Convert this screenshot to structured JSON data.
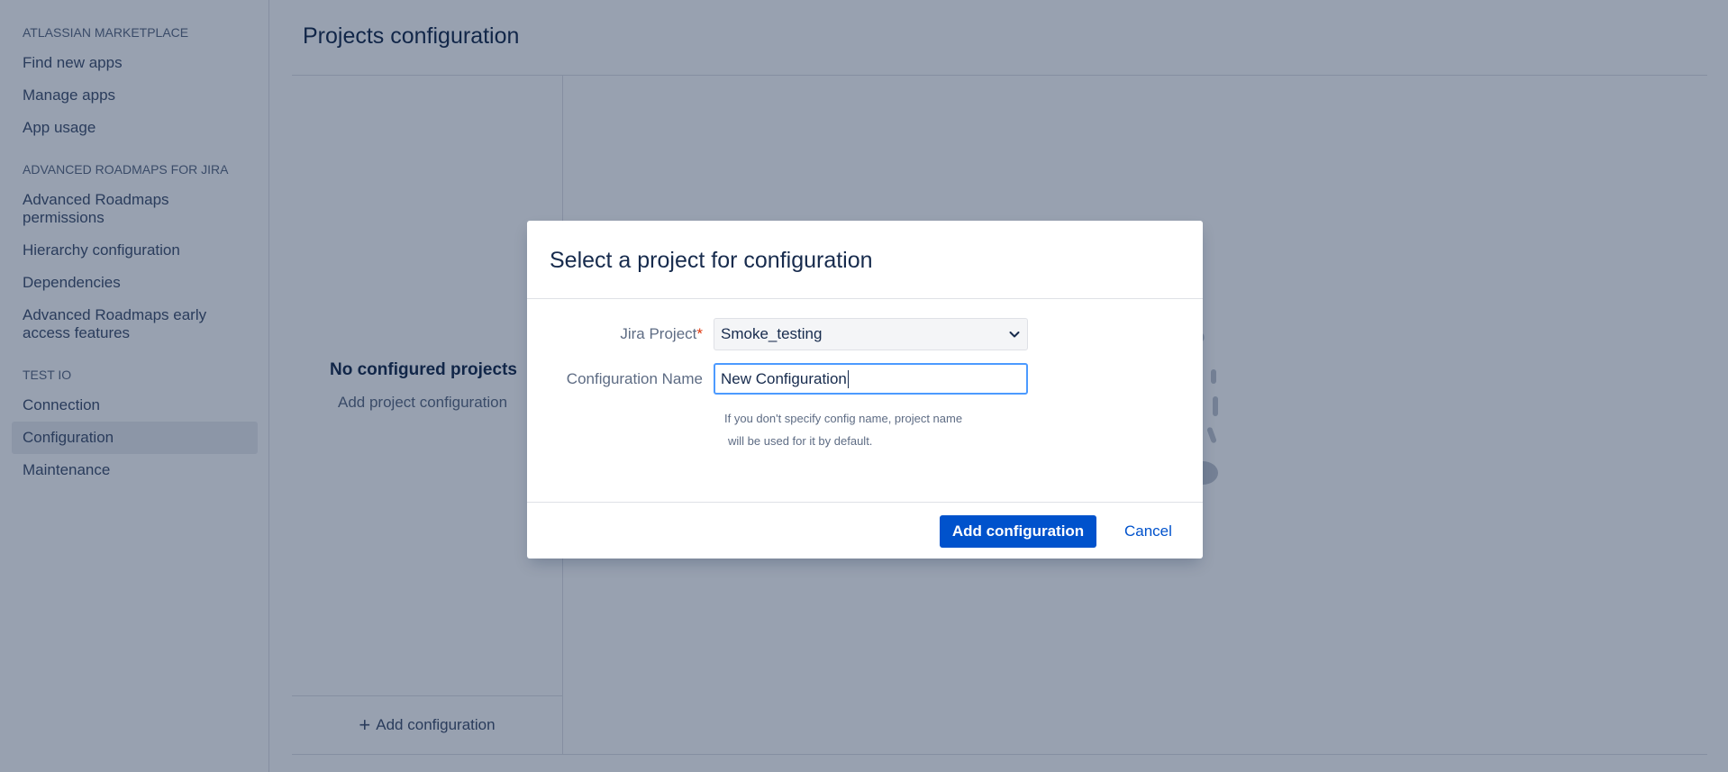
{
  "sidebar": {
    "groups": [
      {
        "title": "ATLASSIAN MARKETPLACE",
        "items": [
          "Find new apps",
          "Manage apps",
          "App usage"
        ]
      },
      {
        "title": "ADVANCED ROADMAPS FOR JIRA",
        "items": [
          "Advanced Roadmaps permissions",
          "Hierarchy configuration",
          "Dependencies",
          "Advanced Roadmaps early access features"
        ]
      },
      {
        "title": "TEST IO",
        "items": [
          "Connection",
          "Configuration",
          "Maintenance"
        ],
        "active": "Configuration"
      }
    ]
  },
  "main": {
    "title": "Projects configuration",
    "empty_title": "No configured projects",
    "empty_subtitle": "Add project configuration",
    "add_configuration_label": "Add configuration"
  },
  "modal": {
    "title": "Select a project for configuration",
    "jira_project_label": "Jira Project",
    "required_mark": "*",
    "jira_project_value": "Smoke_testing",
    "config_name_label": "Configuration Name",
    "config_name_value": "New Configuration",
    "help_line1": "If you don't specify config name, project name",
    "help_line2": "will be used for it by default.",
    "primary_button": "Add configuration",
    "cancel_button": "Cancel"
  },
  "colors": {
    "primary": "#0052cc",
    "overlay": "rgba(9, 30, 66, 0.42)",
    "required": "#de350b",
    "focus_border": "#4c9aff"
  }
}
